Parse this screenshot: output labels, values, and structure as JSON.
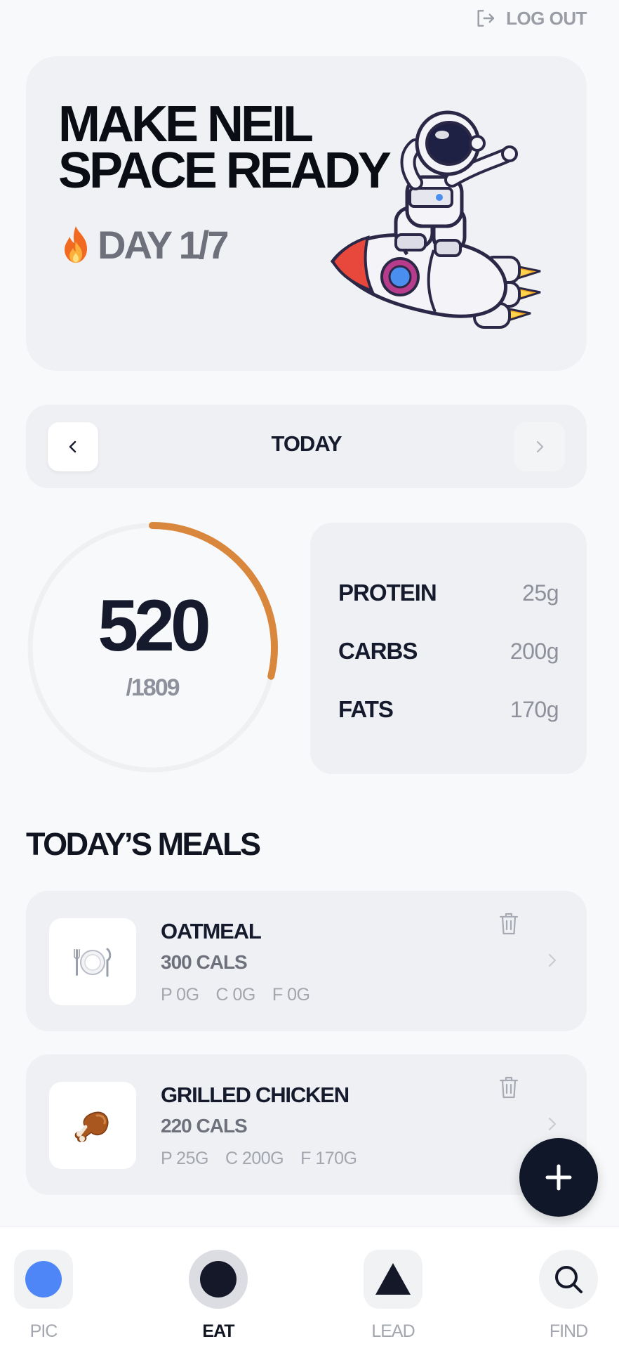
{
  "header": {
    "logout_label": "LOG OUT"
  },
  "hero": {
    "title_line1": "MAKE NEIL",
    "title_line2": "SPACE READY",
    "day_label": "DAY 1/7"
  },
  "date_nav": {
    "label": "TODAY"
  },
  "calories": {
    "consumed": "520",
    "goal_text": "/1809",
    "progress_fraction": 0.2875,
    "ring_color": "#d9873c"
  },
  "macros": [
    {
      "label": "PROTEIN",
      "value": "25g"
    },
    {
      "label": "CARBS",
      "value": "200g"
    },
    {
      "label": "FATS",
      "value": "170g"
    }
  ],
  "meals_section": {
    "title": "TODAY’S MEALS"
  },
  "meals": [
    {
      "name": "OATMEAL",
      "cals": "300 CALS",
      "p": "P 0G",
      "c": "C 0G",
      "f": "F 0G",
      "icon": "plate-icon"
    },
    {
      "name": "GRILLED CHICKEN",
      "cals": "220 CALS",
      "p": "P 25G",
      "c": "C 200G",
      "f": "F 170G",
      "icon": "drumstick-icon"
    }
  ],
  "bottom_nav": [
    {
      "label": "PIC",
      "icon": "blue-dot-icon",
      "active": false
    },
    {
      "label": "EAT",
      "icon": "black-dot-icon",
      "active": true
    },
    {
      "label": "LEAD",
      "icon": "triangle-icon",
      "active": false
    },
    {
      "label": "FIND",
      "icon": "search-icon",
      "active": false
    }
  ],
  "colors": {
    "accent_ring": "#d9873c",
    "dark": "#151a2d",
    "pic_blue": "#4f86f7"
  }
}
